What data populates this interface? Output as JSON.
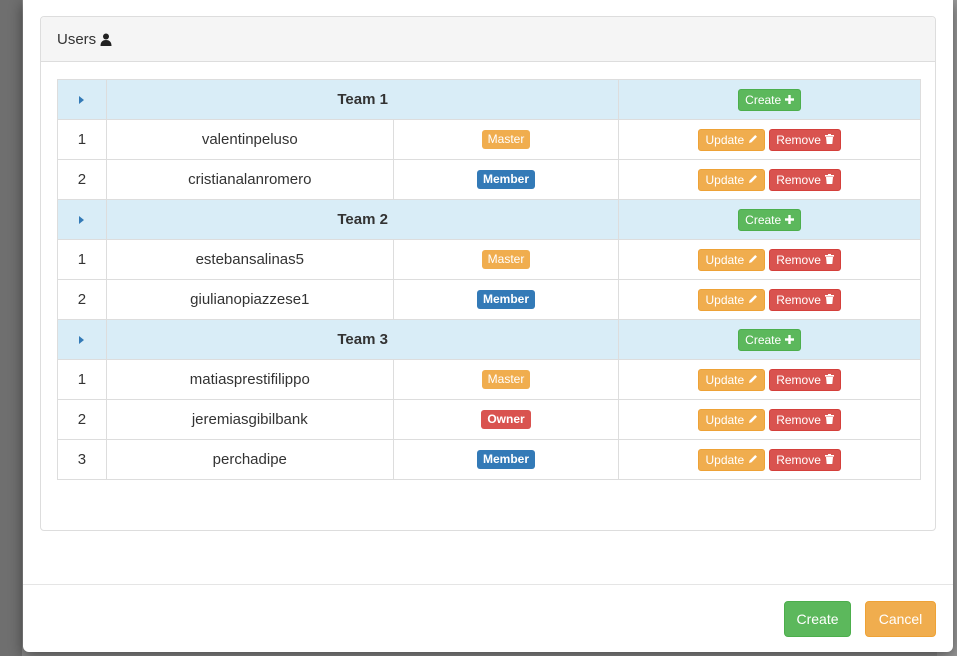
{
  "panel": {
    "title": "Users"
  },
  "labels": {
    "create": "Create",
    "update": "Update",
    "remove": "Remove"
  },
  "teams": [
    {
      "name": "Team 1",
      "members": [
        {
          "index": "1",
          "username": "valentinpeluso",
          "role": "Master"
        },
        {
          "index": "2",
          "username": "cristianalanromero",
          "role": "Member"
        }
      ]
    },
    {
      "name": "Team 2",
      "members": [
        {
          "index": "1",
          "username": "estebansalinas5",
          "role": "Master"
        },
        {
          "index": "2",
          "username": "giulianopiazzese1",
          "role": "Member"
        }
      ]
    },
    {
      "name": "Team 3",
      "members": [
        {
          "index": "1",
          "username": "matiasprestifilippo",
          "role": "Master"
        },
        {
          "index": "2",
          "username": "jeremiasgibilbank",
          "role": "Owner"
        },
        {
          "index": "3",
          "username": "perchadipe",
          "role": "Member"
        }
      ]
    }
  ],
  "footer": {
    "create_label": "Create",
    "cancel_label": "Cancel"
  },
  "colors": {
    "success": "#5cb85c",
    "warning": "#f0ad4e",
    "danger": "#d9534f",
    "primary": "#337ab7",
    "team_row_bg": "#d9edf7"
  },
  "icons": {
    "panel_title": "user-icon",
    "team_toggle": "caret-right-icon",
    "create": "plus-icon",
    "update": "pencil-icon",
    "remove": "trash-icon"
  }
}
